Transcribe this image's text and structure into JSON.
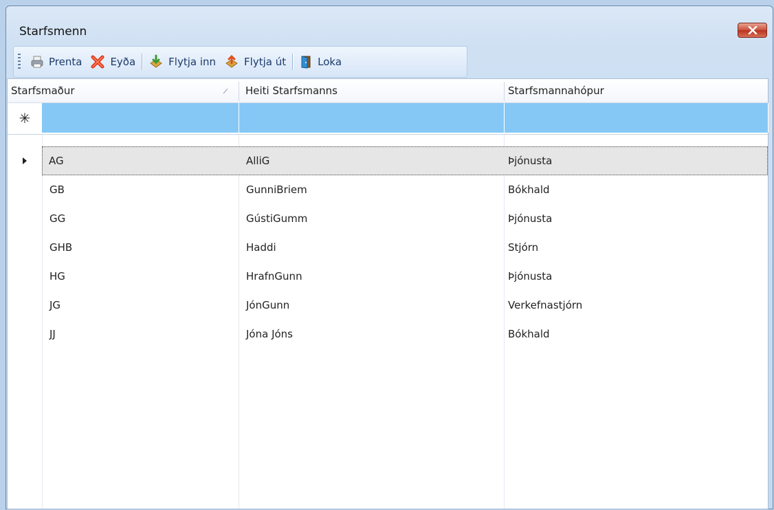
{
  "window": {
    "title": "Starfsmenn"
  },
  "toolbar": {
    "print": "Prenta",
    "delete": "Eyða",
    "import": "Flytja inn",
    "export": "Flytja út",
    "close": "Loka"
  },
  "grid": {
    "columns": [
      "Starfsmaður",
      "Heiti Starfsmanns",
      "Starfsmannahópur"
    ],
    "new_row_marker": "✳",
    "rows": [
      {
        "code": "AG",
        "name": "AlliG",
        "group": "Þjónusta"
      },
      {
        "code": "GB",
        "name": "GunniBriem",
        "group": "Bókhald"
      },
      {
        "code": "GG",
        "name": "GústiGumm",
        "group": "Þjónusta"
      },
      {
        "code": "GHB",
        "name": "Haddi",
        "group": "Stjórn"
      },
      {
        "code": "HG",
        "name": "HrafnGunn",
        "group": "Þjónusta"
      },
      {
        "code": "JG",
        "name": "JónGunn",
        "group": "Verkefnastjórn"
      },
      {
        "code": "JJ",
        "name": "Jóna Jóns",
        "group": "Bókhald"
      }
    ],
    "selected_row": 0
  },
  "colors": {
    "new_row": "#86c8f5",
    "selected_row": "#e6e6e6",
    "close_button": "#c9503b"
  }
}
